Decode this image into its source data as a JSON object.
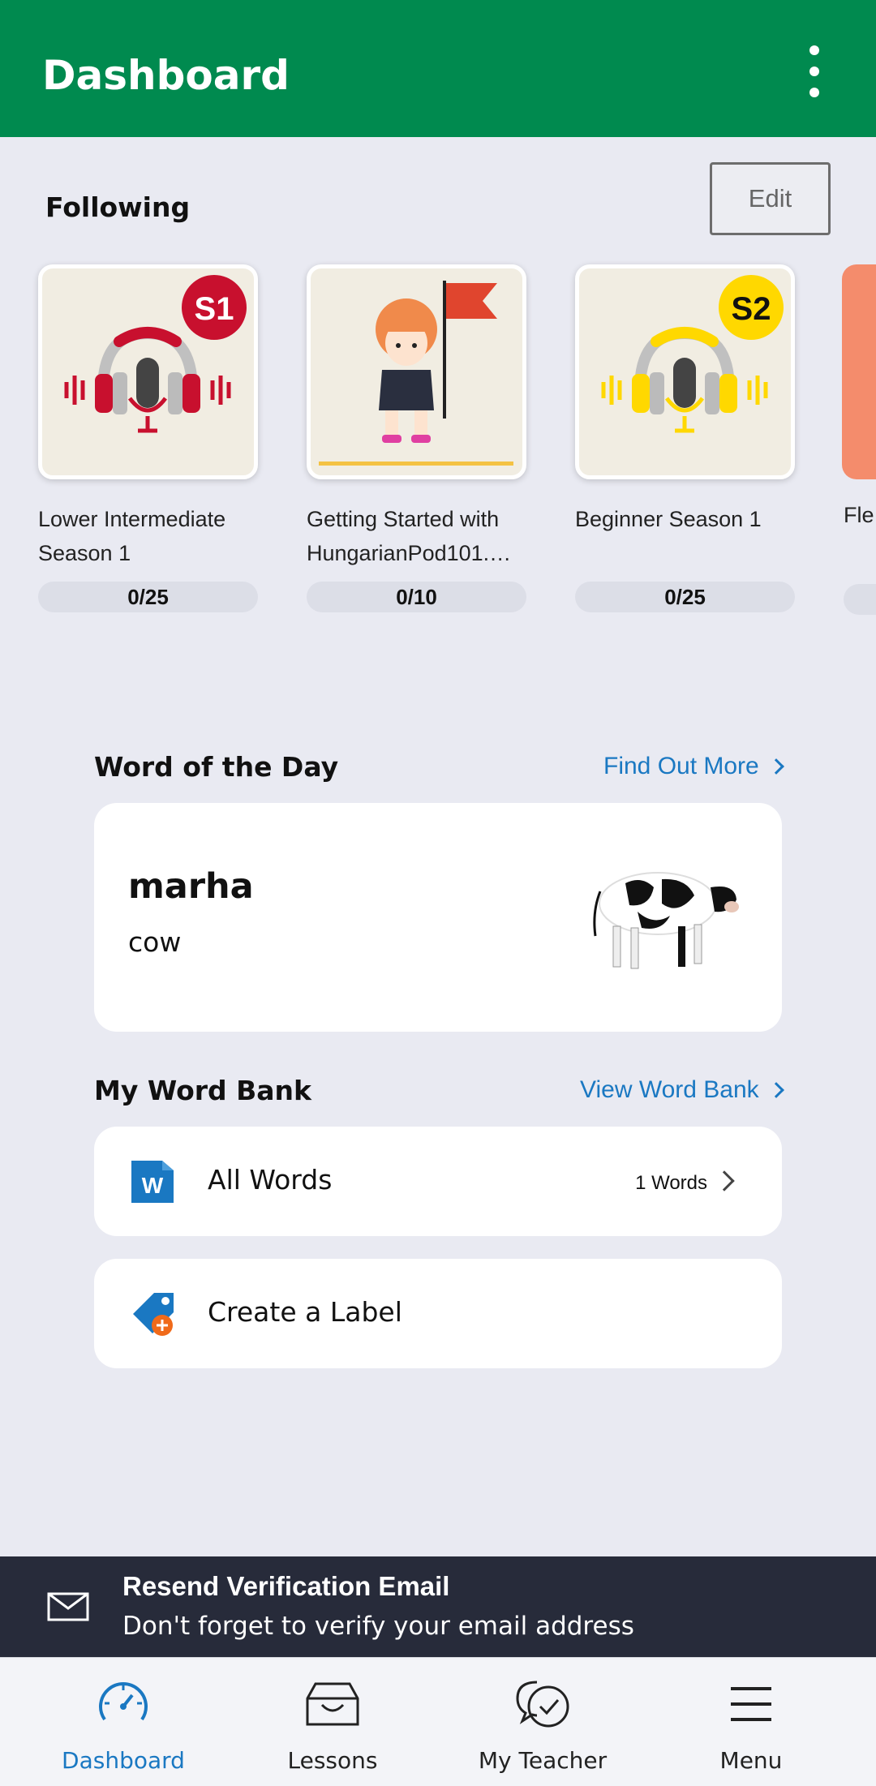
{
  "appbar": {
    "title": "Dashboard",
    "menu_icon": "kebab-menu-icon"
  },
  "following": {
    "label": "Following",
    "edit_label": "Edit",
    "courses": [
      {
        "title": "Lower Intermediate Season 1",
        "progress": "0/25",
        "badge": "S1",
        "badge_color": "#c8102e"
      },
      {
        "title": "Getting Started with HungarianPod101.…",
        "progress": "0/10",
        "badge": "",
        "badge_color": ""
      },
      {
        "title": "Beginner Season 1",
        "progress": "0/25",
        "badge": "S2",
        "badge_color": "#ffd800"
      },
      {
        "title": "Fle",
        "progress": "",
        "badge": "",
        "badge_color": ""
      }
    ]
  },
  "word_of_day": {
    "heading": "Word of the Day",
    "link": "Find Out More",
    "word": "marha",
    "meaning": "cow",
    "image_icon": "cow-image"
  },
  "word_bank": {
    "heading": "My Word Bank",
    "link": "View Word Bank",
    "all_words_label": "All Words",
    "all_words_count": "1 Words",
    "create_label": "Create a Label"
  },
  "banner": {
    "title": "Resend Verification Email",
    "subtitle": "Don't forget to verify your email address"
  },
  "bottom_nav": [
    {
      "label": "Dashboard",
      "icon": "gauge-icon",
      "active": true
    },
    {
      "label": "Lessons",
      "icon": "inbox-icon",
      "active": false
    },
    {
      "label": "My Teacher",
      "icon": "chat-bubbles-icon",
      "active": false
    },
    {
      "label": "Menu",
      "icon": "hamburger-icon",
      "active": false
    }
  ],
  "colors": {
    "primary": "#008a4f",
    "link": "#1a78c2",
    "banner": "#272b3a"
  }
}
